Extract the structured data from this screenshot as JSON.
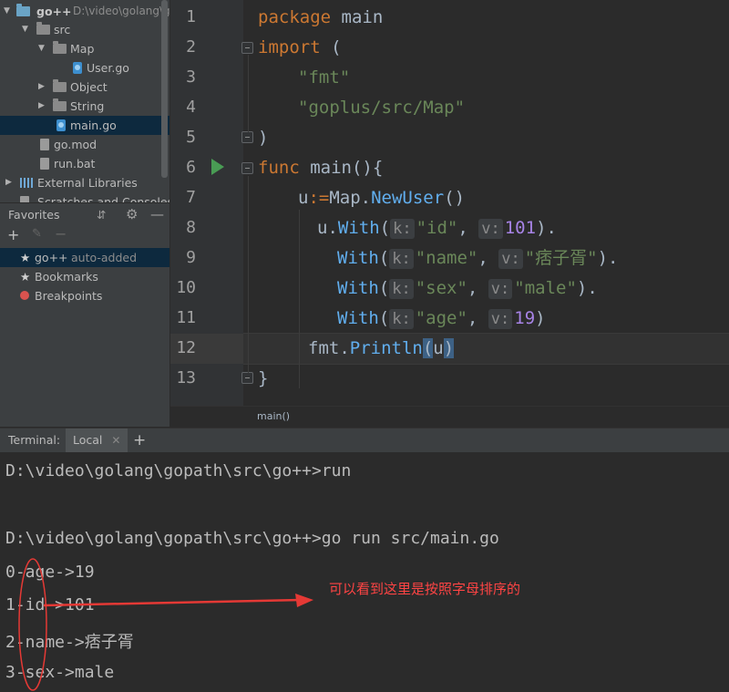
{
  "project": {
    "root_name": "go++",
    "root_path": "D:\\video\\golang\\gopath\\src\\go++",
    "items": [
      {
        "label": "src",
        "type": "folder",
        "level": 1,
        "expanded": true
      },
      {
        "label": "Map",
        "type": "folder",
        "level": 2,
        "expanded": true
      },
      {
        "label": "User.go",
        "type": "go-file",
        "level": 3
      },
      {
        "label": "Object",
        "type": "folder",
        "level": 2,
        "expanded": false
      },
      {
        "label": "String",
        "type": "folder",
        "level": 2,
        "expanded": false
      },
      {
        "label": "main.go",
        "type": "go-file",
        "level": 2,
        "selected": true
      },
      {
        "label": "go.mod",
        "type": "file",
        "level": 1
      },
      {
        "label": "run.bat",
        "type": "file",
        "level": 1
      },
      {
        "label": "External Libraries",
        "type": "library",
        "level": 0
      },
      {
        "label": "Scratches and Consoles",
        "type": "scratch",
        "level": 0
      }
    ]
  },
  "favorites": {
    "title": "Favorites",
    "items": [
      {
        "label": "go++",
        "suffix": "auto-added",
        "icon": "star-icon",
        "selected": true
      },
      {
        "label": "Bookmarks",
        "icon": "star-icon"
      },
      {
        "label": "Breakpoints",
        "icon": "red-dot-icon"
      }
    ]
  },
  "editor": {
    "line_numbers": [
      "1",
      "2",
      "3",
      "4",
      "5",
      "6",
      "7",
      "8",
      "9",
      "10",
      "11",
      "12",
      "13"
    ],
    "current_line": "12",
    "code": {
      "l1_kw": "package",
      "l1_id": " main",
      "l2_kw": "import",
      "l2_p": " (",
      "l3_str": "\"fmt\"",
      "l4_str": "\"goplus/src/Map\"",
      "l5_p": ")",
      "l6_kw": "func",
      "l6_fn": " main",
      "l6_p": "(){",
      "l7_a": "u",
      "l7_op": ":=",
      "l7_b": "Map.",
      "l7_fn": "NewUser",
      "l7_p": "()",
      "l8_a": "u.",
      "l8_fn": "With",
      "l8_k": "k:",
      "l8_kstr": "\"id\"",
      "l8_v": "v:",
      "l8_num": "101",
      "l8_end": ").",
      "l9_fn": "With",
      "l9_k": "k:",
      "l9_kstr": "\"name\"",
      "l9_v": "v:",
      "l9_vstr": "\"痞子胥\"",
      "l9_end": ").",
      "l10_fn": "With",
      "l10_k": "k:",
      "l10_kstr": "\"sex\"",
      "l10_v": "v:",
      "l10_vstr": "\"male\"",
      "l10_end": ").",
      "l11_fn": "With",
      "l11_k": "k:",
      "l11_kstr": "\"age\"",
      "l11_v": "v:",
      "l11_num": "19",
      "l11_end": ")",
      "l12_a": "fmt.",
      "l12_fn": "Println",
      "l12_p1": "(",
      "l12_arg": "u",
      "l12_p2": ")",
      "l13_p": "}"
    },
    "breadcrumb": "main()"
  },
  "terminal": {
    "label": "Terminal:",
    "tab": "Local",
    "lines": [
      "D:\\video\\golang\\gopath\\src\\go++>run",
      "",
      "D:\\video\\golang\\gopath\\src\\go++>go run src/main.go",
      "0-age->19",
      "1-id->101",
      "2-name->痞子胥",
      "3-sex->male"
    ]
  },
  "annotation": {
    "text": "可以看到这里是按照字母排序的",
    "color": "#ff4444"
  },
  "colors": {
    "keyword": "#cc7832",
    "string": "#6a8759",
    "function": "#61aeee",
    "number": "#a783e6",
    "run_icon": "#499c54"
  }
}
